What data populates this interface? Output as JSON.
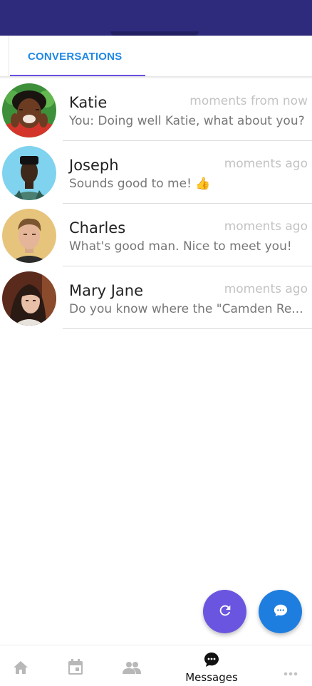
{
  "tabs": [
    {
      "label": "CONVERSATIONS",
      "active": true
    }
  ],
  "conversations": [
    {
      "name": "Katie",
      "time": "moments from now",
      "preview": "You: Doing well Katie, what about you?"
    },
    {
      "name": "Joseph",
      "time": "moments ago",
      "preview": "Sounds good to me! 👍"
    },
    {
      "name": "Charles",
      "time": "moments ago",
      "preview": "What's good man. Nice to meet you!"
    },
    {
      "name": "Mary Jane",
      "time": "moments ago",
      "preview": "Do you know where the \"Camden Re..."
    }
  ],
  "fabs": {
    "refresh_icon": "refresh-icon",
    "new_message_icon": "chat-bubble-icon"
  },
  "bottom_nav": {
    "home_icon": "home-icon",
    "calendar_icon": "calendar-icon",
    "people_icon": "people-icon",
    "messages_label": "Messages",
    "messages_icon": "chat-bubble-icon",
    "more_icon": "more-dots-icon"
  },
  "colors": {
    "header": "#2e2a7c",
    "tab_text": "#1f87e6",
    "tab_indicator": "#6a4fe0",
    "fab_refresh": "#6a55e0",
    "fab_chat": "#1e7ee0",
    "timestamp": "#c3c3c3"
  }
}
